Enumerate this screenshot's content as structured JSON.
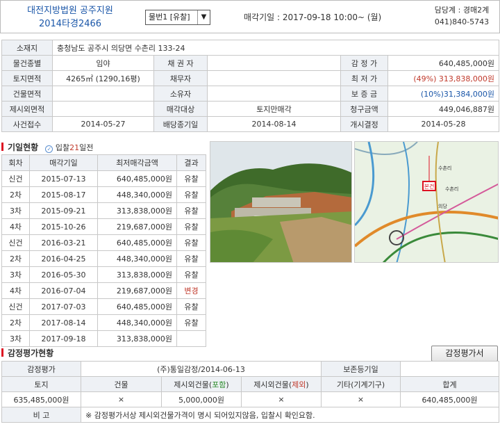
{
  "header": {
    "court": "대전지방법원 공주지원",
    "case_no": "2014타경2466",
    "item_select": "물번1 [유찰]",
    "sale_datetime": "매각기일 : 2017-09-18   10:00~ (월)",
    "dept": "담당계 : 경매2계",
    "phone": "041)840-5743"
  },
  "info": {
    "location_label": "소재지",
    "location": "충청남도 공주시 의당면 수촌리 133-24",
    "type_label": "물건종별",
    "type": "임야",
    "creditor_label": "채 권 자",
    "creditor": "",
    "appraisal_label": "감 정 가",
    "appraisal": "640,485,000원",
    "land_label": "토지면적",
    "land": "4265㎡ (1290,16평)",
    "debtor_label": "채무자",
    "debtor": "",
    "minimum_label": "최 저 가",
    "minimum": "(49%) 313,838,000원",
    "bldg_label": "건물면적",
    "bldg": "",
    "owner_label": "소유자",
    "owner": "",
    "deposit_label": "보 증 금",
    "deposit": "(10%)31,384,000원",
    "excl_label": "제시외면적",
    "excl": "",
    "target_label": "매각대상",
    "target": "토지만매각",
    "claim_label": "청구금액",
    "claim": "449,046,887원",
    "filed_label": "사건접수",
    "filed": "2014-05-27",
    "dividend_label": "배당종기일",
    "dividend": "2014-08-14",
    "commence_label": "개시결정",
    "commence": "2014-05-28"
  },
  "history_section": {
    "title": "기일현황",
    "ddayword": "입찰",
    "dday": "21",
    "ddaysuffix": "일전",
    "columns": [
      "회차",
      "매각기일",
      "최저매각금액",
      "결과"
    ],
    "rows": [
      {
        "round": "신건",
        "date": "2015-07-13",
        "price": "640,485,000원",
        "result": "유찰"
      },
      {
        "round": "2차",
        "date": "2015-08-17",
        "price": "448,340,000원",
        "result": "유찰"
      },
      {
        "round": "3차",
        "date": "2015-09-21",
        "price": "313,838,000원",
        "result": "유찰"
      },
      {
        "round": "4차",
        "date": "2015-10-26",
        "price": "219,687,000원",
        "result": "유찰"
      },
      {
        "round": "신건",
        "date": "2016-03-21",
        "price": "640,485,000원",
        "result": "유찰"
      },
      {
        "round": "2차",
        "date": "2016-04-25",
        "price": "448,340,000원",
        "result": "유찰"
      },
      {
        "round": "3차",
        "date": "2016-05-30",
        "price": "313,838,000원",
        "result": "유찰"
      },
      {
        "round": "4차",
        "date": "2016-07-04",
        "price": "219,687,000원",
        "result": "변경"
      },
      {
        "round": "신건",
        "date": "2017-07-03",
        "price": "640,485,000원",
        "result": "유찰"
      },
      {
        "round": "2차",
        "date": "2017-08-14",
        "price": "448,340,000원",
        "result": "유찰"
      },
      {
        "round": "3차",
        "date": "2017-09-18",
        "price": "313,838,000원",
        "result": ""
      }
    ]
  },
  "map": {
    "marker": "본건",
    "labels": [
      "수촌리",
      "의당",
      "수촌리"
    ]
  },
  "appraisal_section": {
    "title": "감정평가현황",
    "button": "감정평가서",
    "org_label": "감정평가",
    "org": "(주)통일감정/2014-06-13",
    "preserve_label": "보존등기일",
    "preserve": "",
    "col_land": "토지",
    "col_bldg": "건물",
    "col_incl_pre": "제시외건물(",
    "col_incl_mid": "포함",
    "col_excl_mid": "제외",
    "col_close": ")",
    "col_etc": "기타(기계기구)",
    "col_total": "합계",
    "v_land": "635,485,000원",
    "v_bldg": "×",
    "v_incl": "5,000,000원",
    "v_excl": "×",
    "v_etc": "×",
    "v_total": "640,485,000원",
    "note_label": "비 고",
    "note": "※ 감정평가서상 제시외건물가격이 명시 되어있지않음, 입찰시 확인요함."
  }
}
